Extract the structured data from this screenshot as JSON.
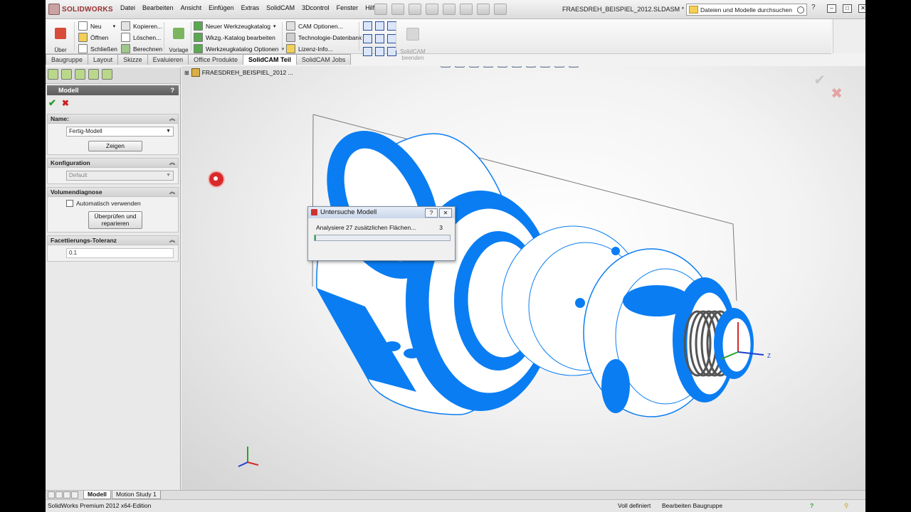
{
  "app": {
    "logo": "SOLIDWORKS",
    "document_title": "FRAESDREH_BEISPIEL_2012.SLDASM *"
  },
  "menu": [
    "Datei",
    "Bearbeiten",
    "Ansicht",
    "Einfügen",
    "Extras",
    "SolidCAM",
    "3Dcontrol",
    "Fenster",
    "Hilfe"
  ],
  "search": {
    "placeholder": "Dateien und Modelle durchsuchen"
  },
  "commandmanager": {
    "uber": "Über\nSolidCAM",
    "neu": "Neu",
    "offnen": "Öffnen",
    "schliessen": "Schließen",
    "kopieren": "Kopieren...",
    "loschen": "Löschen...",
    "berechnen": "Berechnen",
    "vorlage": "Vorlage\nöffnen",
    "neuer_katalog": "Neuer Werkzeugkatalog",
    "katalog_bearbeiten": "Wkzg.-Katalog bearbeiten",
    "katalog_optionen": "Werkzeugkatalog Optionen",
    "cam_optionen": "CAM Optionen...",
    "tech_db": "Technologie-Datenbank",
    "lizenz": "Lizenz-Info...",
    "beenden": "SolidCAM\nbeenden"
  },
  "tabs": [
    {
      "label": "Baugruppe",
      "active": false
    },
    {
      "label": "Layout",
      "active": false
    },
    {
      "label": "Skizze",
      "active": false
    },
    {
      "label": "Evaluieren",
      "active": false
    },
    {
      "label": "Office Produkte",
      "active": false
    },
    {
      "label": "SolidCAM Teil",
      "active": true
    },
    {
      "label": "SolidCAM Jobs",
      "active": false
    }
  ],
  "panel": {
    "title": "Modell",
    "help": "?",
    "ok": "✔",
    "cancel": "✖",
    "name_label": "Name:",
    "name_value": "Fertig-Modell",
    "show_button": "Zeigen",
    "config_label": "Konfiguration",
    "config_value": "Default",
    "volume_label": "Volumendiagnose",
    "auto_use": "Automatisch verwenden",
    "check_button": "Überprüfen und\nreparieren",
    "facet_label": "Facettierungs-Toleranz",
    "facet_value": "0.1"
  },
  "viewport": {
    "tree_item": "FRAESDREH_BEISPIEL_2012 ..."
  },
  "dialog": {
    "title": "Untersuche Modell",
    "help": "?",
    "close": "✕",
    "message": "Analysiere 27 zusätzlichen Flächen...",
    "count": "3",
    "progress": 0.01
  },
  "bottom_tabs": [
    {
      "label": "Modell",
      "active": true
    },
    {
      "label": "Motion Study 1",
      "active": false
    }
  ],
  "status": {
    "left": "SolidWorks Premium 2012 x64-Edition",
    "defined": "Voll definiert",
    "editing": "Bearbeiten Baugruppe"
  },
  "colors": {
    "model_blue": "#0a7df2",
    "accent_green": "#28b83a",
    "cancel_red": "#cc1f1f"
  }
}
